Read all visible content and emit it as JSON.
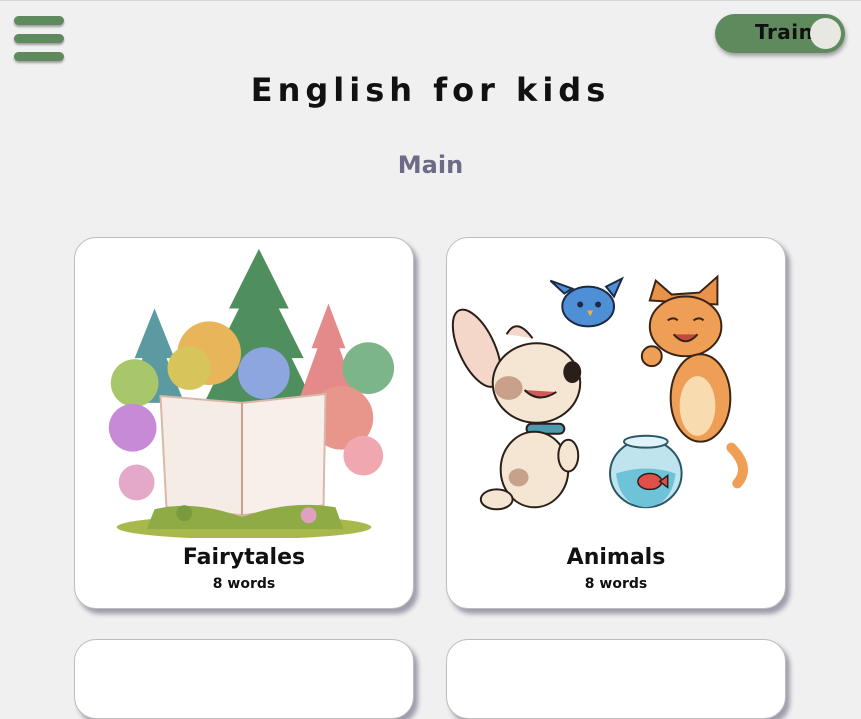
{
  "header": {
    "menu_icon": "hamburger-menu-icon",
    "mode_toggle_label": "Train",
    "app_title": "English for kids",
    "page_heading": "Main"
  },
  "theme": {
    "accent": "#5e8a5e",
    "heading": "#6c6c88"
  },
  "categories": [
    {
      "title": "Fairytales",
      "subtitle": "8 words",
      "image": "storybook-forest-illustration"
    },
    {
      "title": "Animals",
      "subtitle": "8 words",
      "image": "dog-cat-bird-fishbowl-illustration"
    }
  ]
}
